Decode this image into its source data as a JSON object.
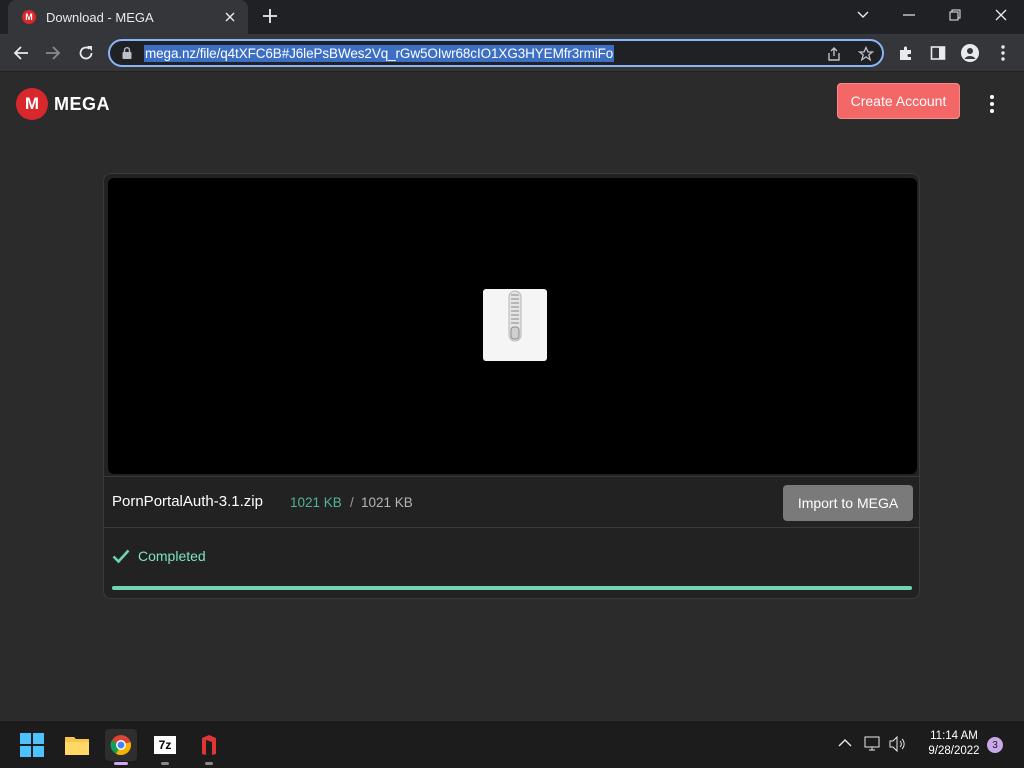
{
  "browser": {
    "tab_title": "Download - MEGA",
    "favicon_letter": "M",
    "url": "mega.nz/file/q4tXFC6B#J6lePsBWes2Vq_rGw5OIwr68cIO1XG3HYEMfr3rmiFo"
  },
  "page": {
    "logo_letter": "M",
    "logo_text": "MEGA",
    "create_account_label": "Create Account",
    "file_name": "PornPortalAuth-3.1.zip",
    "size_downloaded": "1021 KB",
    "size_separator": "/",
    "size_total": "1021 KB",
    "import_label": "Import to MEGA",
    "status_label": "Completed",
    "progress": 1.0
  },
  "taskbar": {
    "seven_zip_label": "7z",
    "clock_time": "11:14 AM",
    "clock_date": "9/28/2022",
    "notification_count": "3"
  },
  "colors": {
    "brand_red": "#d9272e",
    "create_button": "#f46767",
    "progress_fill": "#6fd3b4",
    "status_text": "#7fe3c7"
  }
}
